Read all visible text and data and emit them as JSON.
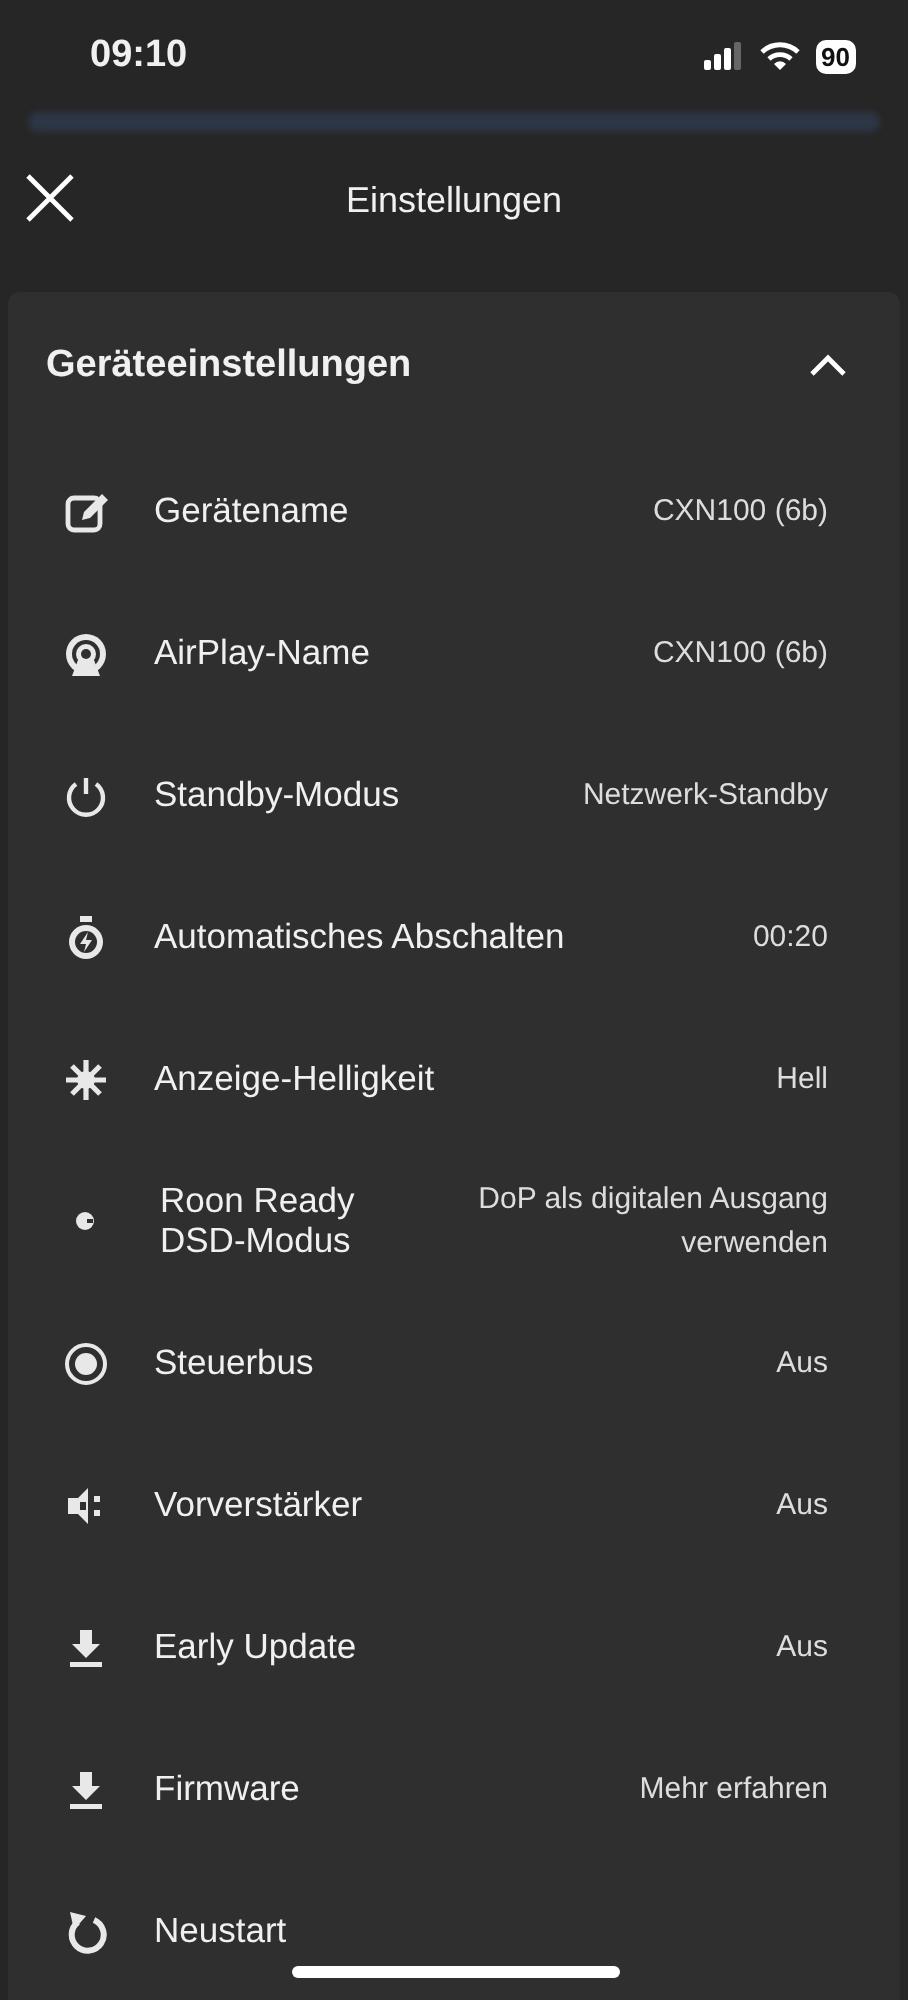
{
  "status_bar": {
    "time": "09:10",
    "battery": "90"
  },
  "header": {
    "title": "Einstellungen"
  },
  "section": {
    "title": "Geräteeinstellungen",
    "expanded": true,
    "items": [
      {
        "label": "Gerätename",
        "value": "CXN100 (6b)"
      },
      {
        "label": "AirPlay-Name",
        "value": "CXN100 (6b)"
      },
      {
        "label": "Standby-Modus",
        "value": "Netzwerk-Standby"
      },
      {
        "label": "Automatisches Abschalten",
        "value": "00:20"
      },
      {
        "label": "Anzeige-Helligkeit",
        "value": "Hell"
      },
      {
        "label": "Roon Ready DSD-Modus",
        "value": "DoP als digitalen Ausgang verwenden"
      },
      {
        "label": "Steuerbus",
        "value": "Aus"
      },
      {
        "label": "Vorverstärker",
        "value": "Aus"
      },
      {
        "label": "Early Update",
        "value": "Aus"
      },
      {
        "label": "Firmware",
        "value": "Mehr erfahren"
      },
      {
        "label": "Neustart"
      }
    ]
  }
}
